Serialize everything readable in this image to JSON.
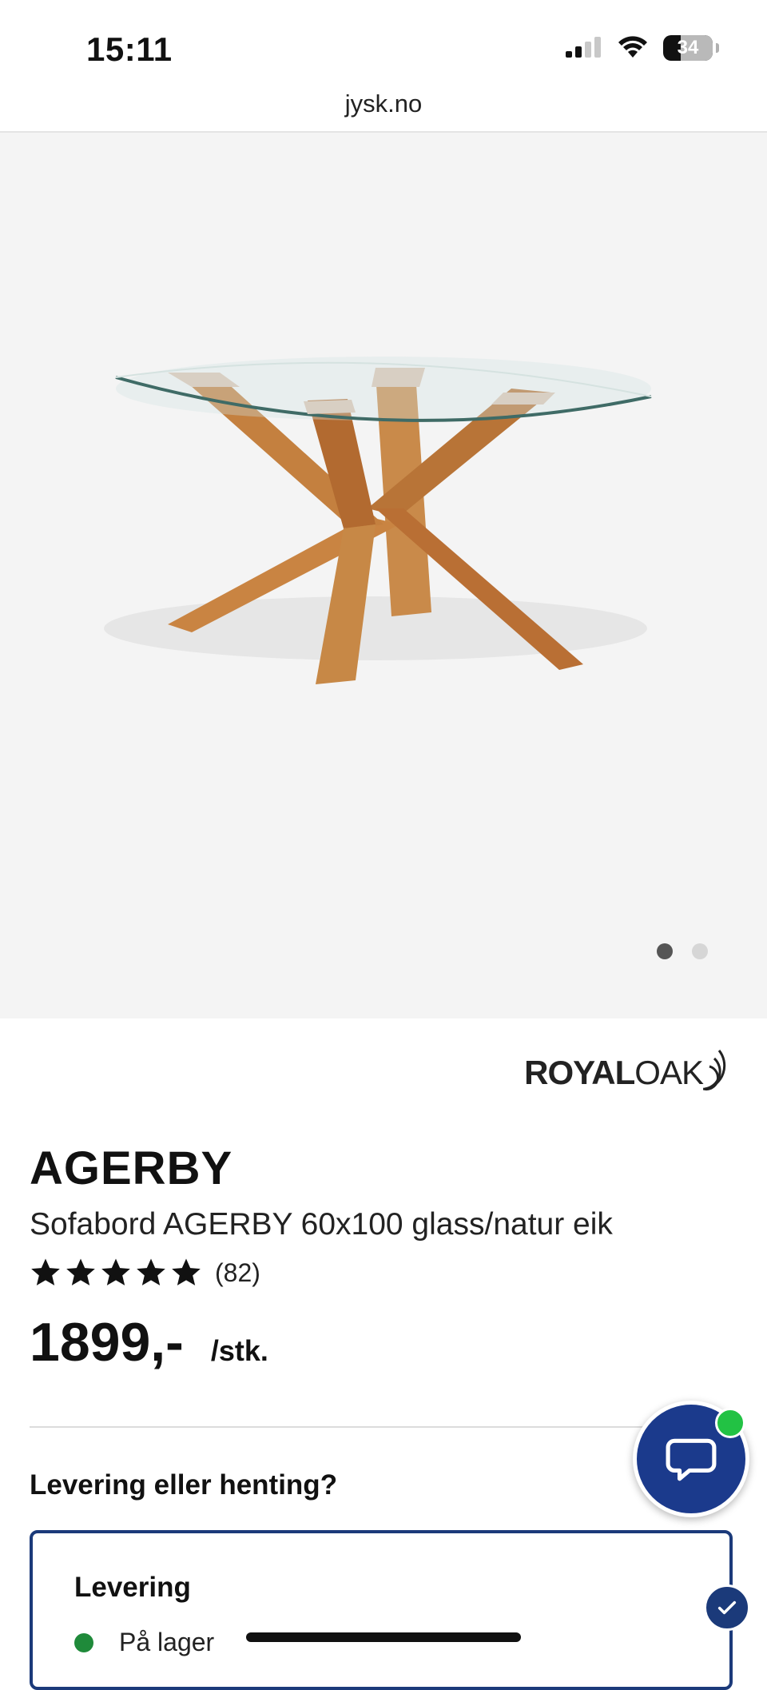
{
  "status_bar": {
    "time": "15:11",
    "battery": "34"
  },
  "browser": {
    "url": "jysk.no"
  },
  "gallery": {
    "image_name": "AGERBY coffee table",
    "slides": 2,
    "active_slide": 1
  },
  "brand": {
    "royal": "ROYAL",
    "oak": "OAK"
  },
  "product": {
    "title": "AGERBY",
    "subtitle": "Sofabord AGERBY 60x100 glass/natur eik",
    "rating": 5,
    "review_count": "(82)",
    "price": "1899,-",
    "unit": "/stk."
  },
  "delivery": {
    "heading": "Levering eller henting?",
    "option_label": "Levering",
    "stock_text": "På lager",
    "stock_color": "#1f8a3a"
  },
  "colors": {
    "accent": "#1b3a8c",
    "online": "#22c244"
  }
}
